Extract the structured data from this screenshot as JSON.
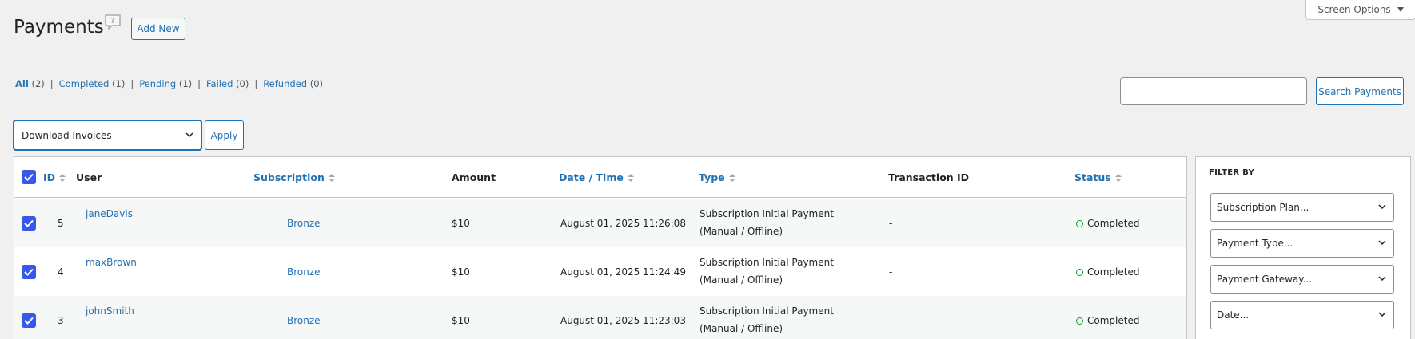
{
  "header": {
    "title": "Payments",
    "add_new_label": "Add New",
    "screen_options_label": "Screen Options"
  },
  "views": [
    {
      "label": "All",
      "count": "(2)"
    },
    {
      "label": "Completed",
      "count": "(1)"
    },
    {
      "label": "Pending",
      "count": "(1)"
    },
    {
      "label": "Failed",
      "count": "(0)"
    },
    {
      "label": "Refunded",
      "count": "(0)"
    }
  ],
  "search": {
    "value": "",
    "placeholder": "",
    "button_label": "Search Payments"
  },
  "bulk_actions": {
    "selected": "Download Invoices",
    "apply_label": "Apply"
  },
  "table": {
    "columns": {
      "id": "ID",
      "user": "User",
      "subscription": "Subscription",
      "amount": "Amount",
      "date": "Date / Time",
      "type": "Type",
      "transaction": "Transaction ID",
      "status": "Status"
    },
    "rows": [
      {
        "id": "5",
        "user": "janeDavis",
        "subscription": "Bronze",
        "amount": "$10",
        "date": "August 01, 2025 11:26:08",
        "type": "Subscription Initial Payment (Manual / Offline)",
        "transaction": "-",
        "status": "Completed",
        "checked": true
      },
      {
        "id": "4",
        "user": "maxBrown",
        "subscription": "Bronze",
        "amount": "$10",
        "date": "August 01, 2025 11:24:49",
        "type": "Subscription Initial Payment (Manual / Offline)",
        "transaction": "-",
        "status": "Completed",
        "checked": true
      },
      {
        "id": "3",
        "user": "johnSmith",
        "subscription": "Bronze",
        "amount": "$10",
        "date": "August 01, 2025 11:23:03",
        "type": "Subscription Initial Payment (Manual / Offline)",
        "transaction": "-",
        "status": "Completed",
        "checked": true
      }
    ]
  },
  "filter": {
    "title": "FILTER BY",
    "selects": [
      "Subscription Plan...",
      "Payment Type...",
      "Payment Gateway...",
      "Date..."
    ]
  },
  "colors": {
    "link": "#2271b1",
    "checkbox": "#3858e9",
    "status_completed": "#00a32a",
    "background": "#f0f0f1"
  }
}
